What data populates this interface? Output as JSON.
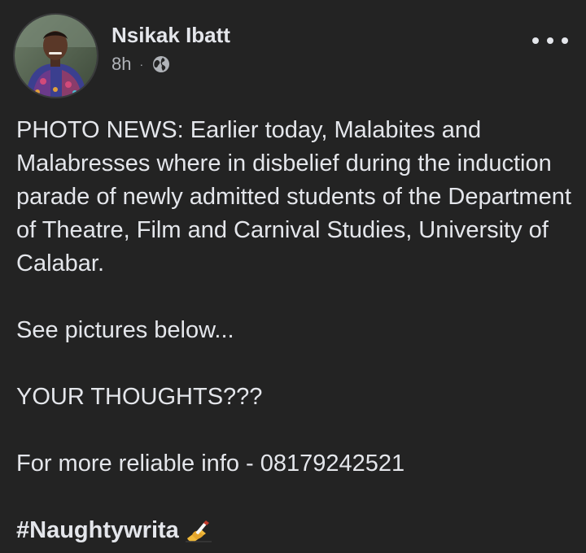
{
  "post": {
    "author": "Nsikak Ibatt",
    "time": "8h",
    "separator": "·",
    "audience_icon": "globe-icon",
    "menu_icon": "more-horizontal-icon",
    "paragraphs": [
      "PHOTO NEWS: Earlier today, Malabites and Malabresses where in disbelief during the induction parade of newly admitted students of the Department of Theatre, Film and Carnival Studies, University of Calabar.",
      "See pictures below...",
      "YOUR THOUGHTS???",
      "For more reliable info - 08179242521"
    ],
    "hashtag": "#Naughtywrita",
    "emoji": "✍️",
    "colors": {
      "background": "#232323",
      "text": "#e4e6eb",
      "secondary_text": "#b0b3b8"
    }
  }
}
